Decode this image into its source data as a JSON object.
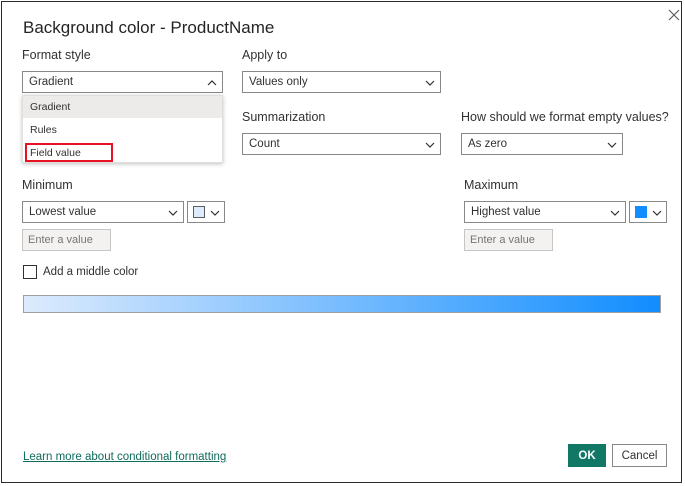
{
  "dialog": {
    "title": "Background color - ProductName",
    "close_icon": "close-icon"
  },
  "format_style": {
    "label": "Format style",
    "value": "Gradient",
    "options": [
      "Gradient",
      "Rules",
      "Field value"
    ],
    "highlighted_option": "Field value"
  },
  "apply_to": {
    "label": "Apply to",
    "value": "Values only"
  },
  "summarization": {
    "label": "Summarization",
    "value": "Count"
  },
  "empty_values": {
    "label": "How should we format empty values?",
    "value": "As zero"
  },
  "minimum": {
    "label": "Minimum",
    "value": "Lowest value",
    "color": "#DDEBFD",
    "input_placeholder": "Enter a value"
  },
  "maximum": {
    "label": "Maximum",
    "value": "Highest value",
    "color": "#118DFF",
    "input_placeholder": "Enter a value"
  },
  "middle_color": {
    "label": "Add a middle color",
    "checked": false
  },
  "gradient_bar": {
    "start_color": "#DDEBFD",
    "end_color": "#118DFF"
  },
  "footer": {
    "learn_more": "Learn more about conditional formatting",
    "ok_label": "OK",
    "cancel_label": "Cancel"
  },
  "colors": {
    "accent": "#117865",
    "highlight_border": "#E81123"
  }
}
